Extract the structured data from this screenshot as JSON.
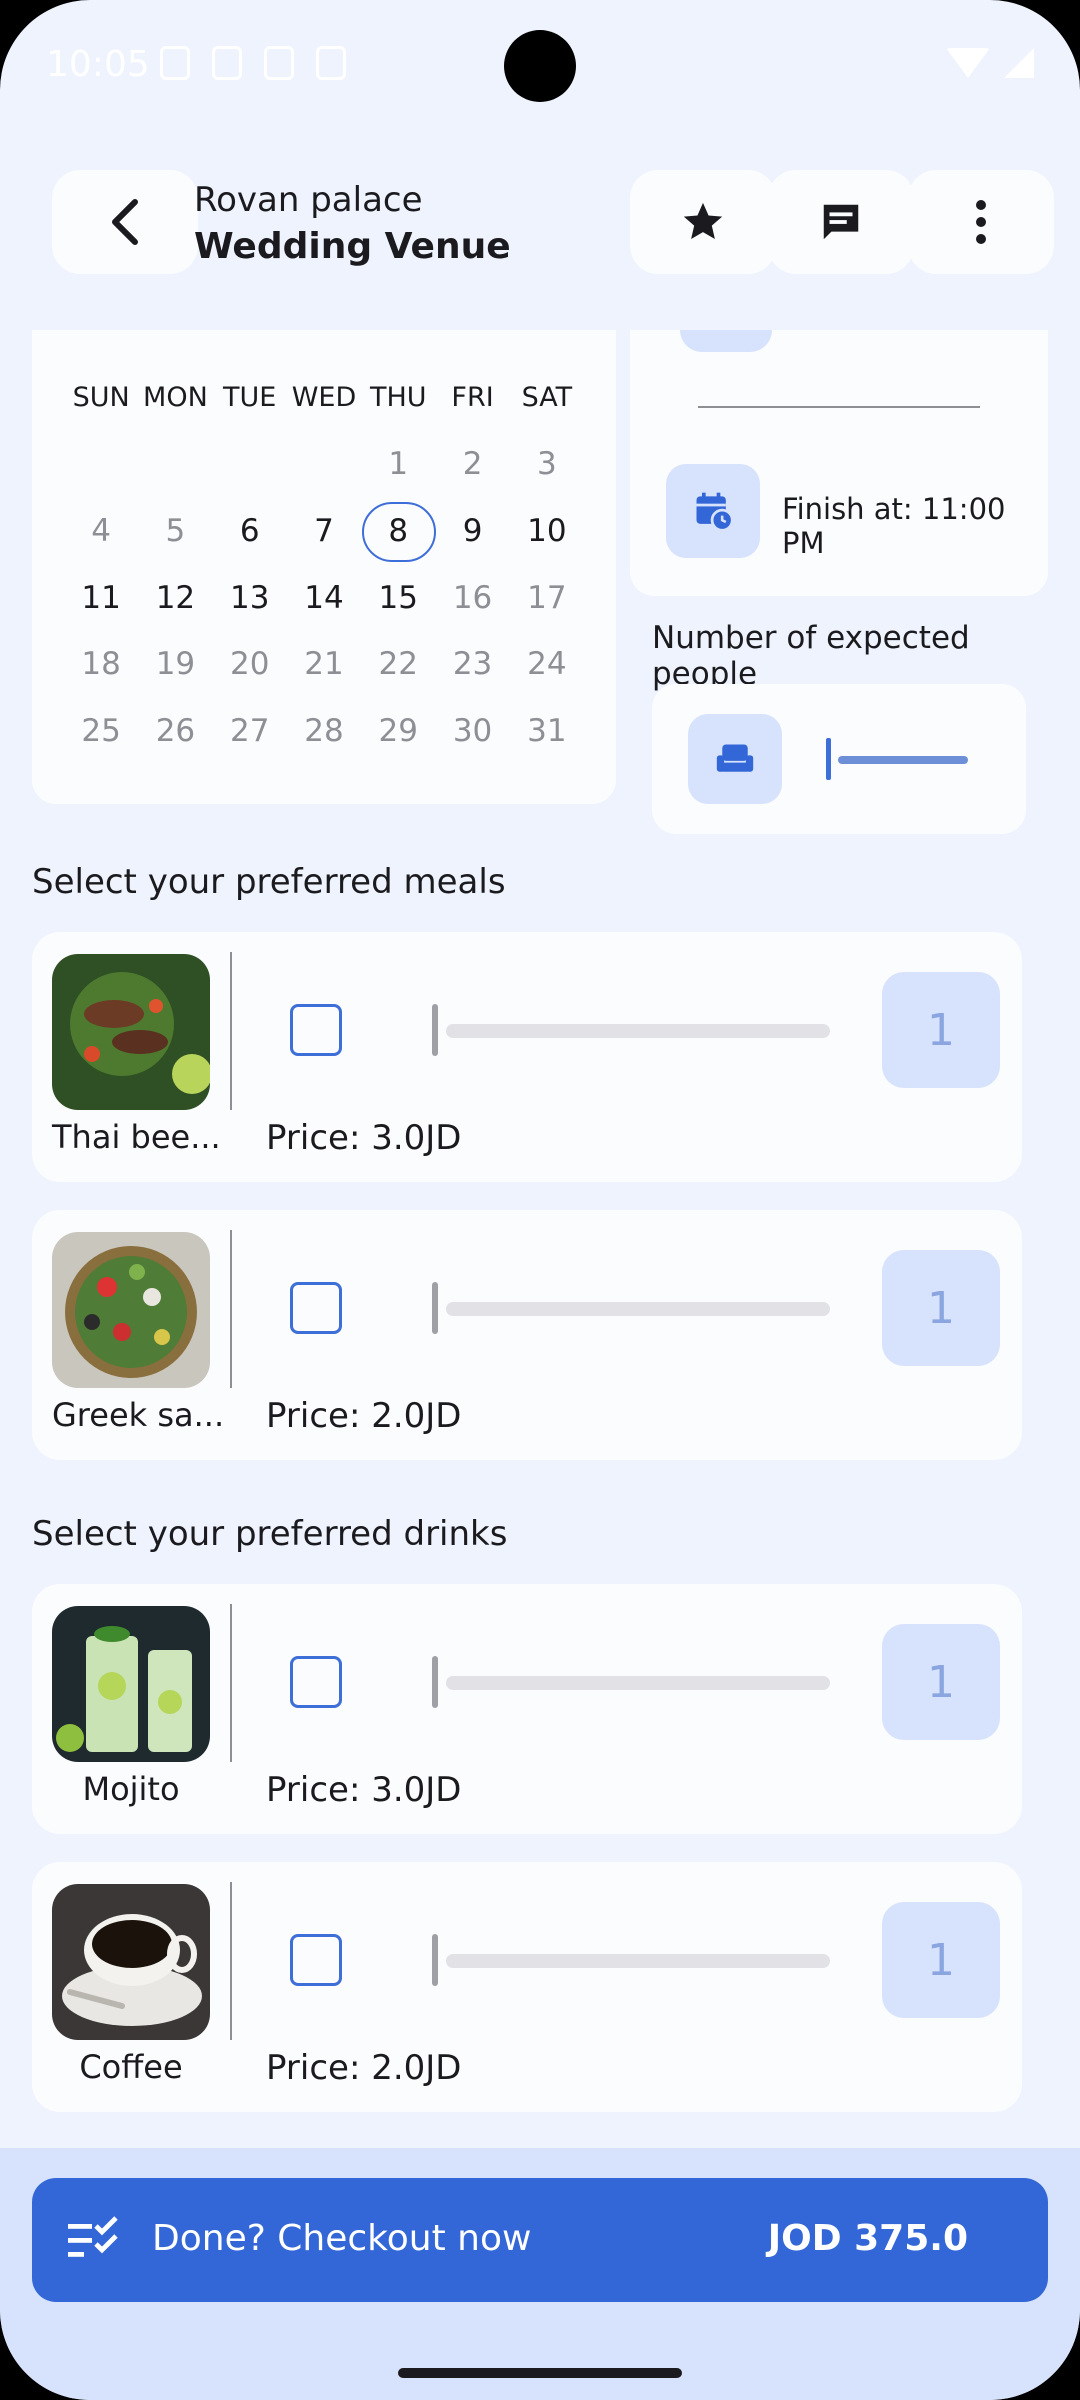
{
  "status_bar": {
    "time": "10:05"
  },
  "header": {
    "subtitle": "Rovan palace",
    "title": "Wedding Venue",
    "icons": [
      "back-arrow-icon",
      "star-icon",
      "chat-icon",
      "more-vert-icon"
    ]
  },
  "calendar": {
    "weekdays": [
      "SUN",
      "MON",
      "TUE",
      "WED",
      "THU",
      "FRI",
      "SAT"
    ],
    "selected_day": "8",
    "rows": [
      [
        "",
        "",
        "",
        "",
        "1",
        "2",
        "3"
      ],
      [
        "4",
        "5",
        "6",
        "7",
        "8",
        "9",
        "10"
      ],
      [
        "11",
        "12",
        "13",
        "14",
        "15",
        "16",
        "17"
      ],
      [
        "18",
        "19",
        "20",
        "21",
        "22",
        "23",
        "24"
      ],
      [
        "25",
        "26",
        "27",
        "28",
        "29",
        "30",
        "31"
      ]
    ]
  },
  "time": {
    "finish_label": "Finish at: 11:00 PM"
  },
  "people": {
    "label": "Number of expected people"
  },
  "meals": {
    "section_label": "Select your preferred meals",
    "items": [
      {
        "name": "Thai bee...",
        "price": "Price: 3.0JD",
        "qty": "1"
      },
      {
        "name": "Greek sa...",
        "price": "Price: 2.0JD",
        "qty": "1"
      }
    ]
  },
  "drinks": {
    "section_label": "Select your preferred drinks",
    "items": [
      {
        "name": "Mojito",
        "price": "Price: 3.0JD",
        "qty": "1"
      },
      {
        "name": "Coffee",
        "price": "Price: 2.0JD",
        "qty": "1"
      }
    ]
  },
  "checkout": {
    "label": "Done? Checkout now",
    "total": "JOD 375.0"
  },
  "colors": {
    "accent": "#3366d6",
    "surface": "#fbfcfe",
    "background": "#eef3fd",
    "tonal": "#d7e3fc"
  }
}
